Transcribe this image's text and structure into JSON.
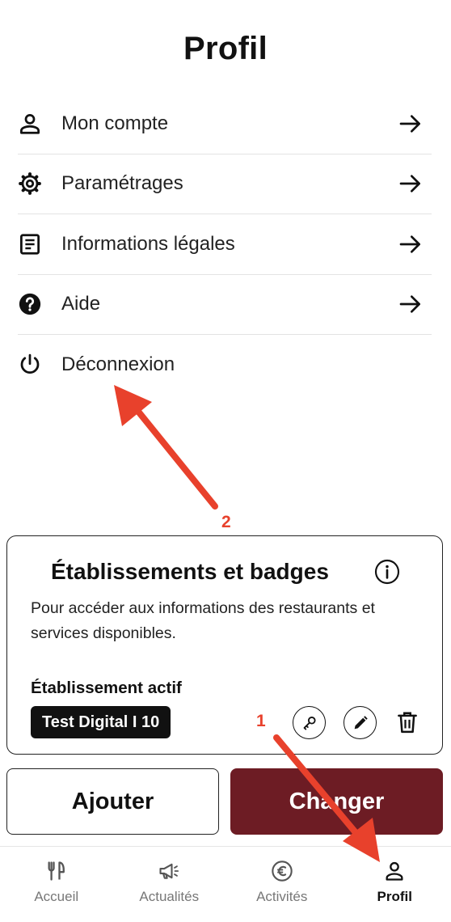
{
  "page": {
    "title": "Profil"
  },
  "menu": {
    "items": [
      {
        "label": "Mon compte",
        "icon": "user-icon"
      },
      {
        "label": "Paramétrages",
        "icon": "gear-icon"
      },
      {
        "label": "Informations légales",
        "icon": "document-icon"
      },
      {
        "label": "Aide",
        "icon": "help-icon"
      },
      {
        "label": "Déconnexion",
        "icon": "power-icon"
      }
    ]
  },
  "card": {
    "title": "Établissements et badges",
    "description": "Pour accéder aux informations des restaurants et services disponibles.",
    "active_label": "Établissement actif",
    "active_badge": "Test Digital I 10"
  },
  "actions": {
    "add_label": "Ajouter",
    "change_label": "Changer"
  },
  "tabbar": {
    "tabs": [
      {
        "label": "Accueil",
        "icon": "cutlery-icon",
        "active": false
      },
      {
        "label": "Actualités",
        "icon": "megaphone-icon",
        "active": false
      },
      {
        "label": "Activités",
        "icon": "euro-icon",
        "active": false
      },
      {
        "label": "Profil",
        "icon": "user-icon",
        "active": true
      }
    ]
  },
  "annotations": {
    "arrow1_label": "1",
    "arrow2_label": "2"
  },
  "colors": {
    "accent": "#6d1c24",
    "annotation": "#e8412c",
    "text": "#111111",
    "divider": "#e3e3e3"
  }
}
